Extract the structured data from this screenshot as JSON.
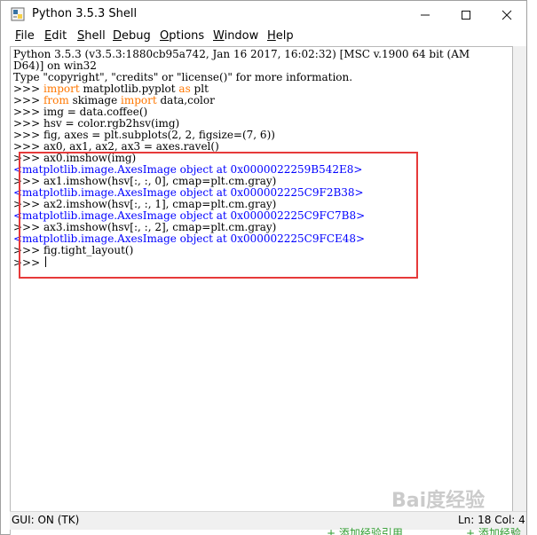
{
  "window": {
    "title": "Python 3.5.3 Shell",
    "minimize_glyph": "—",
    "maximize_glyph": "☐",
    "close_glyph": "✕"
  },
  "menu": [
    "File",
    "Edit",
    "Shell",
    "Debug",
    "Options",
    "Window",
    "Help"
  ],
  "menu_underlines": [
    "F",
    "E",
    "S",
    "D",
    "O",
    "W",
    "H"
  ],
  "code_lines": [
    [
      {
        "t": "Python 3.5.3 (v3.5.3:1880cb95a742, Jan 16 2017, 16:02:32) [MSC v.1900 64 bit (AM",
        "c": "plain"
      }
    ],
    [
      {
        "t": "D64)] on win32",
        "c": "plain"
      }
    ],
    [
      {
        "t": "Type \"copyright\", \"credits\" or \"license()\" for more information.",
        "c": "plain"
      }
    ],
    [
      {
        "t": ">>> ",
        "c": "prompt"
      },
      {
        "t": "import",
        "c": "kw"
      },
      {
        "t": " matplotlib.pyplot ",
        "c": "plain"
      },
      {
        "t": "as",
        "c": "kw"
      },
      {
        "t": " plt",
        "c": "plain"
      }
    ],
    [
      {
        "t": ">>> ",
        "c": "prompt"
      },
      {
        "t": "from",
        "c": "kw"
      },
      {
        "t": " skimage ",
        "c": "plain"
      },
      {
        "t": "import",
        "c": "kw"
      },
      {
        "t": " data,color",
        "c": "plain"
      }
    ],
    [
      {
        "t": ">>> ",
        "c": "prompt"
      },
      {
        "t": "img = data.coffee()",
        "c": "plain"
      }
    ],
    [
      {
        "t": ">>> ",
        "c": "prompt"
      },
      {
        "t": "hsv = color.rgb2hsv(img)",
        "c": "plain"
      }
    ],
    [
      {
        "t": ">>> ",
        "c": "prompt"
      },
      {
        "t": "fig, axes = plt.subplots(2, 2, figsize=(7, 6))",
        "c": "plain"
      }
    ],
    [
      {
        "t": ">>> ",
        "c": "prompt"
      },
      {
        "t": "ax0, ax1, ax2, ax3 = axes.ravel()",
        "c": "plain"
      }
    ],
    [
      {
        "t": ">>> ",
        "c": "prompt"
      },
      {
        "t": "ax0.imshow(img)",
        "c": "plain"
      }
    ],
    [
      {
        "t": "<matplotlib.image.AxesImage object at 0x0000022259B542E8>",
        "c": "out"
      }
    ],
    [
      {
        "t": ">>> ",
        "c": "prompt"
      },
      {
        "t": "ax1.imshow(hsv[:, :, 0], cmap=plt.cm.gray)",
        "c": "plain"
      }
    ],
    [
      {
        "t": "<matplotlib.image.AxesImage object at 0x000002225C9F2B38>",
        "c": "out"
      }
    ],
    [
      {
        "t": ">>> ",
        "c": "prompt"
      },
      {
        "t": "ax2.imshow(hsv[:, :, 1], cmap=plt.cm.gray)",
        "c": "plain"
      }
    ],
    [
      {
        "t": "<matplotlib.image.AxesImage object at 0x000002225C9FC7B8>",
        "c": "out"
      }
    ],
    [
      {
        "t": ">>> ",
        "c": "prompt"
      },
      {
        "t": "ax3.imshow(hsv[:, :, 2], cmap=plt.cm.gray)",
        "c": "plain"
      }
    ],
    [
      {
        "t": "<matplotlib.image.AxesImage object at 0x000002225C9FCE48>",
        "c": "out"
      }
    ],
    [
      {
        "t": ">>> ",
        "c": "prompt"
      },
      {
        "t": "fig.tight_layout()",
        "c": "plain"
      }
    ],
    [
      {
        "t": ">>> ",
        "c": "prompt"
      }
    ]
  ],
  "status": {
    "left": "GUI: ON (TK)",
    "right": "Ln: 18  Col: 4"
  },
  "watermark": "Bai度经验",
  "bottom_hints": [
    "+ 添加经验引用",
    "+ 添加经验参"
  ],
  "colors": {
    "keyword": "#ff7700",
    "output": "#0000ff",
    "highlight_box": "#e63a3a"
  }
}
